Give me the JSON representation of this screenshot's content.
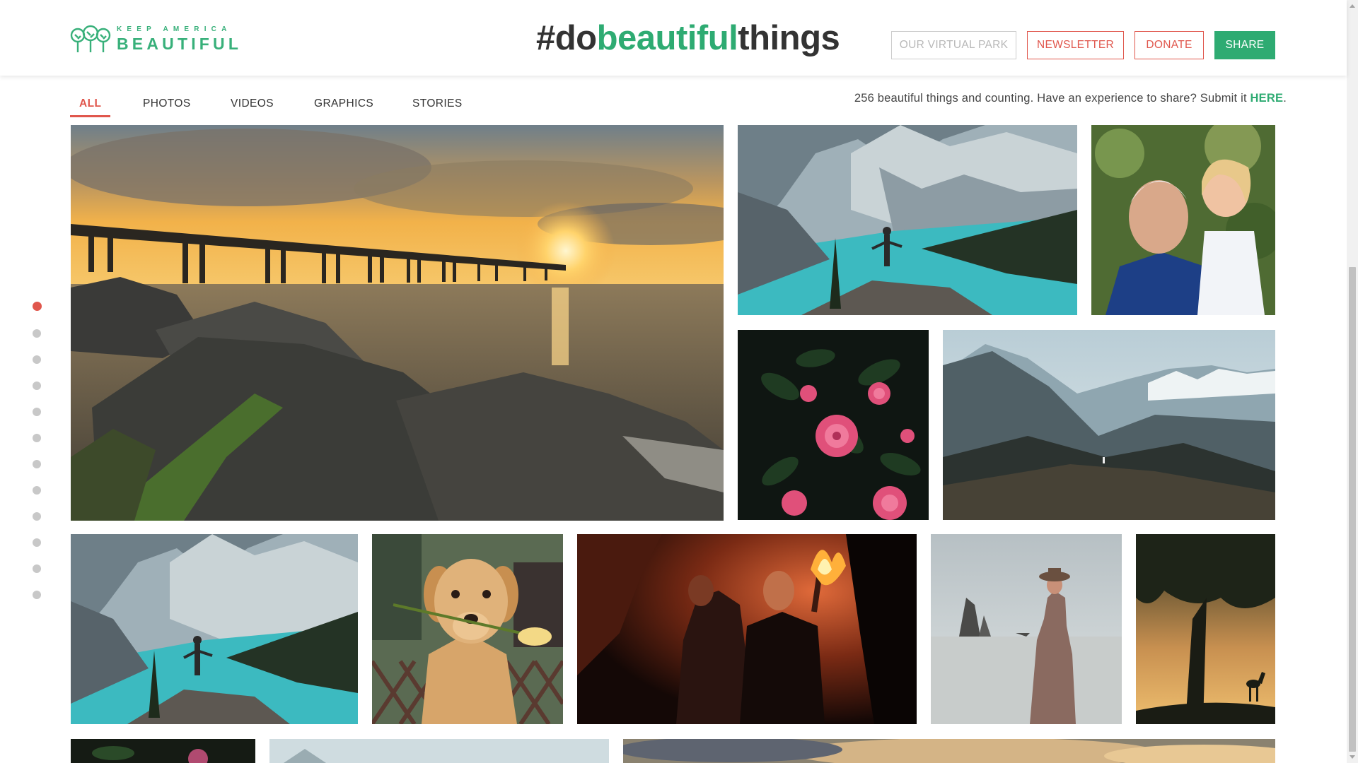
{
  "header": {
    "logo": {
      "top": "KEEP AMERICA",
      "bottom": "BEAUTIFUL",
      "icon": "three-trees-icon"
    },
    "hashtag": {
      "prefix": "#do",
      "highlight": "beautiful",
      "suffix": "things"
    },
    "buttons": {
      "virtual_park": "OUR VIRTUAL PARK",
      "newsletter": "NEWSLETTER",
      "donate": "DONATE",
      "share": "SHARE"
    }
  },
  "tabs": [
    "ALL",
    "PHOTOS",
    "VIDEOS",
    "GRAPHICS",
    "STORIES"
  ],
  "active_tab": "ALL",
  "counter": {
    "text": "256 beautiful things and counting. Have an experience to share? Submit it ",
    "link": "HERE",
    "end": "."
  },
  "side_nav": {
    "count": 12,
    "active_index": 0
  },
  "colors": {
    "brand_green": "#2eab72",
    "accent_red": "#e0564c",
    "text_dark": "#333333"
  },
  "gallery": [
    {
      "name": "photo-pier-sunset",
      "subject": "pier at sunset over rocky shore"
    },
    {
      "name": "photo-moraine-lake-hiker",
      "subject": "hiker on rock above turquoise mountain lake"
    },
    {
      "name": "photo-grandfather-granddaughter",
      "subject": "grandfather holding little girl"
    },
    {
      "name": "photo-pink-camellias",
      "subject": "pink camellia flowers"
    },
    {
      "name": "photo-mountain-valley",
      "subject": "person on hill facing mountain range"
    },
    {
      "name": "photo-moraine-lake-hiker-2",
      "subject": "hiker on rock above turquoise mountain lake"
    },
    {
      "name": "photo-golden-retriever-tulip",
      "subject": "golden retriever holding yellow tulip"
    },
    {
      "name": "photo-cave-torch",
      "subject": "men with torch in a cave"
    },
    {
      "name": "photo-woman-beach",
      "subject": "woman with hat on misty beach"
    },
    {
      "name": "photo-tree-deer-silhouette",
      "subject": "tree and deer silhouette at sunset"
    },
    {
      "name": "photo-flowers-partial",
      "subject": "flowers"
    },
    {
      "name": "photo-mountains-partial",
      "subject": "mountains"
    },
    {
      "name": "photo-clouds-partial",
      "subject": "sunset clouds"
    }
  ]
}
